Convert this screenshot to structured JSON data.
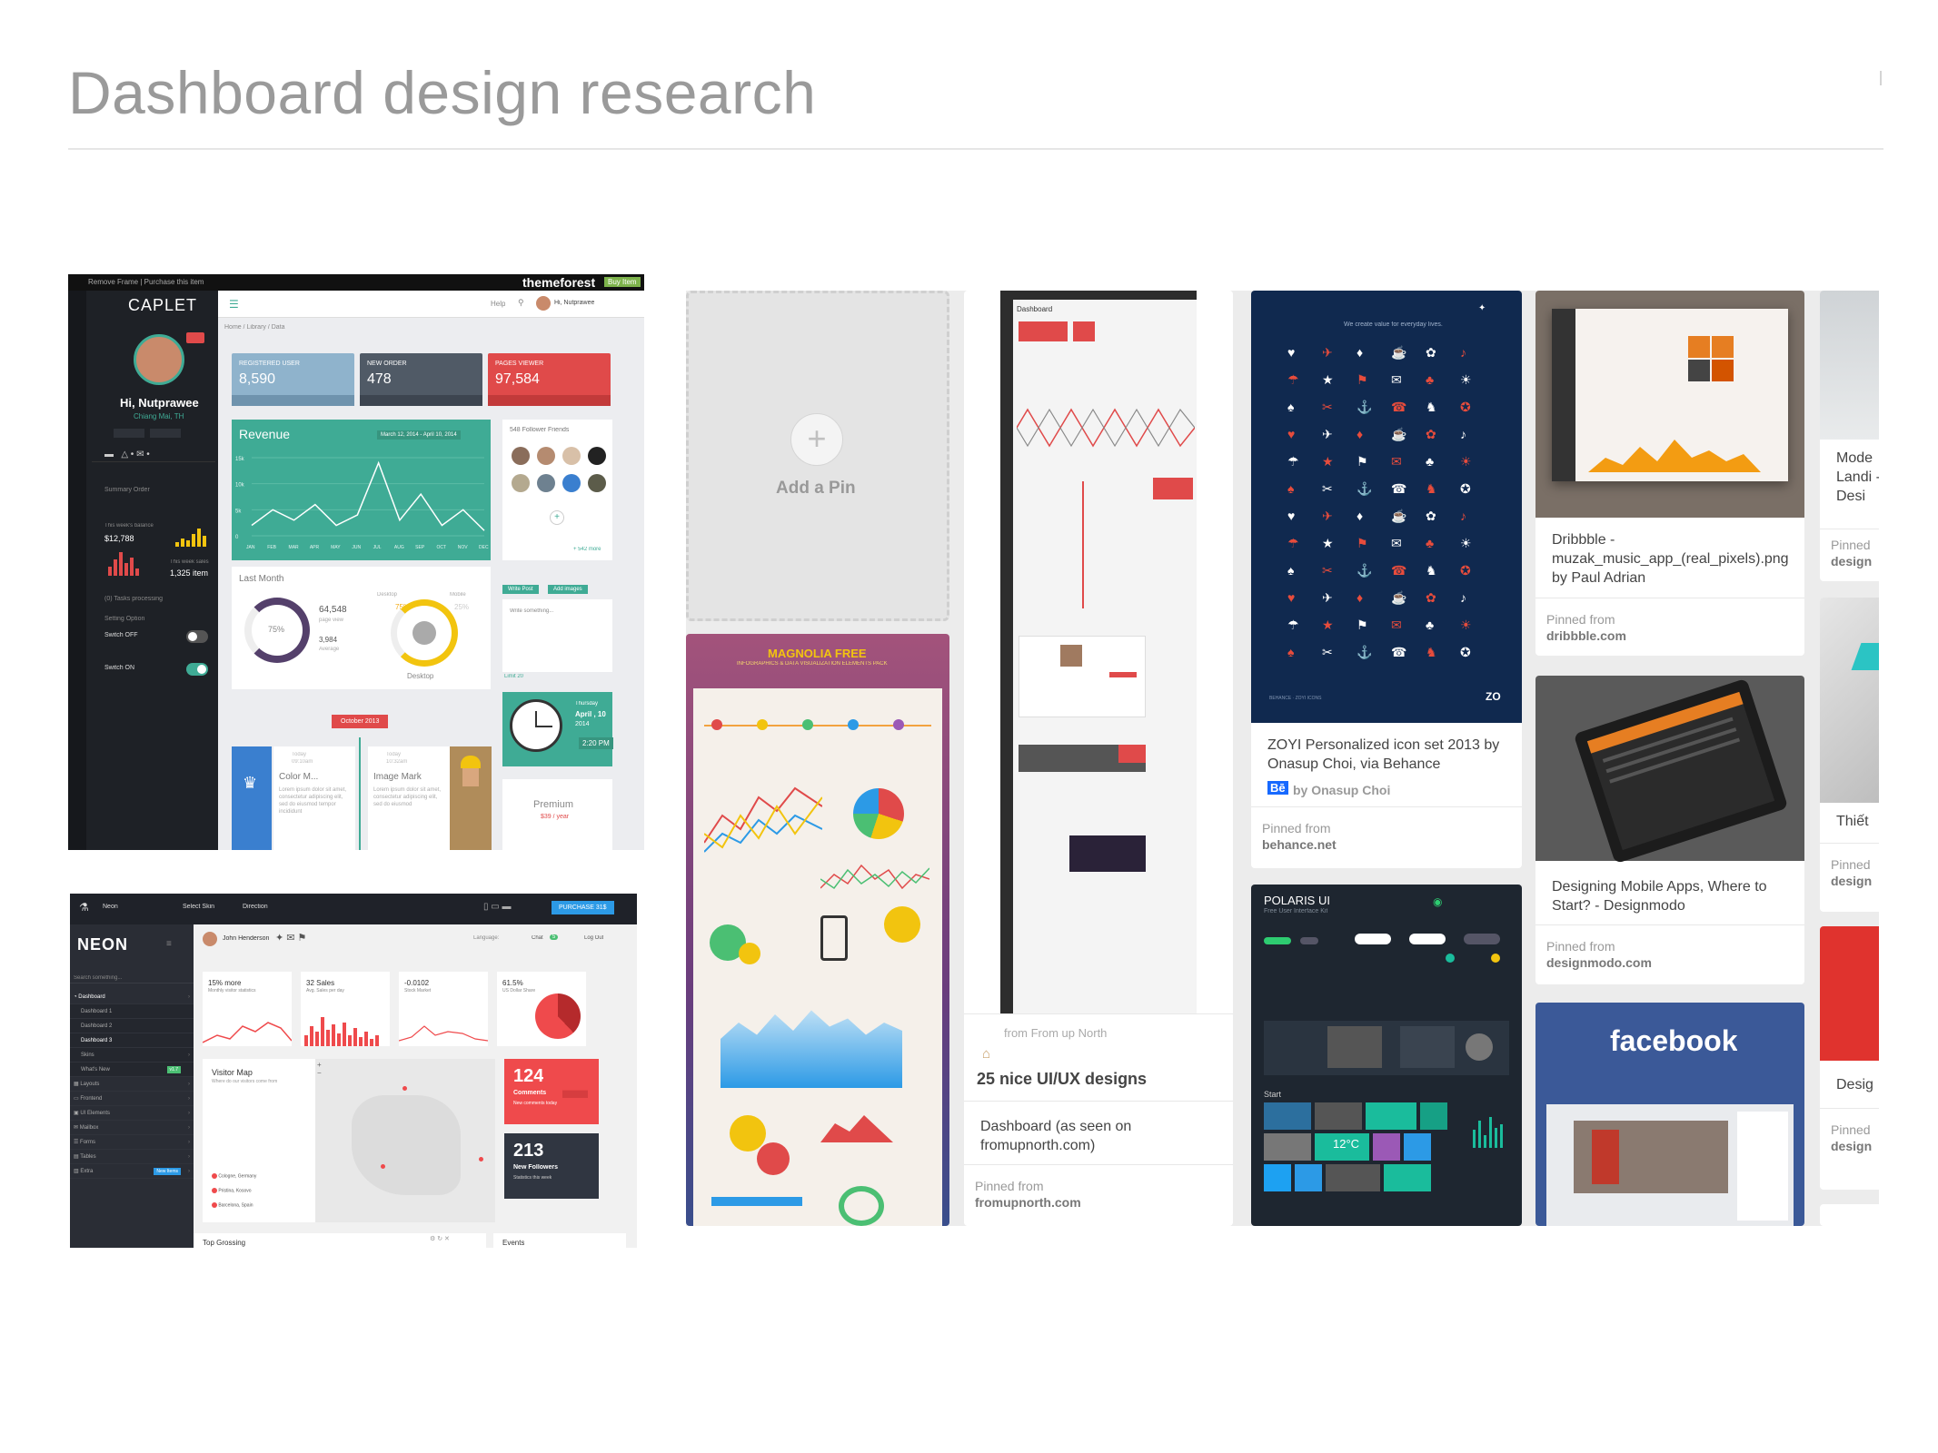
{
  "page": {
    "title": "Dashboard design research"
  },
  "caplet": {
    "banner_left": "Remove Frame   |   Purchase this item",
    "banner_brand": "themeforest",
    "banner_buy": "Buy Item",
    "brand": "CAPLET",
    "greeting": "Hi, Nutprawee",
    "location": "Chiang Mai, TH",
    "breadcrumb": "Home / Library / Data",
    "help": "Help",
    "top_user": "Hi, Nutprawee",
    "summary_label": "Summary Order",
    "balance_label": "This week's balance",
    "balance_value": "$12,788",
    "sales_label": "This week sales",
    "sales_value": "1,325 item",
    "tasks_label": "(0) Tasks processing",
    "setting_label": "Setting Option",
    "switch_off": "Switch OFF",
    "switch_on": "Switch ON",
    "tile1_label": "REGISTERED USER",
    "tile1_value": "8,590",
    "tile2_label": "NEW ORDER",
    "tile2_value": "478",
    "tile3_label": "PAGES VIEWER",
    "tile3_value": "97,584",
    "revenue_title": "Revenue",
    "revenue_range": "March 12, 2014 - April 10, 2014",
    "revenue_yticks": [
      "15k",
      "10k",
      "5k",
      "0"
    ],
    "revenue_months": [
      "JAN",
      "FEB",
      "MAR",
      "APR",
      "MAY",
      "JUN",
      "JUL",
      "AUG",
      "SEP",
      "OCT",
      "NOV",
      "DEC"
    ],
    "revenue_values": [
      2,
      5,
      3,
      6,
      2,
      4,
      14,
      3,
      8,
      2,
      5,
      1
    ],
    "friends_title": "548 Follower Friends",
    "friends_more": "+ 542 more",
    "last_month": "Last Month",
    "pageview_value": "64,548",
    "pageview_label": "page view",
    "avg_value": "3,984",
    "avg_label": "Average",
    "donut_pct": "75%",
    "desktop_legend": "Desktop",
    "mobile_legend": "Mobile",
    "desktop_pct": "75%",
    "mobile_pct": "25%",
    "desktop_label": "Desktop",
    "write_post": "Write Post",
    "add_images": "Add images",
    "write_placeholder": "Write something...",
    "limit": "Limit 20",
    "date_day": "Thursday",
    "date_date": "April , 10",
    "date_year": "2014",
    "date_time": "2:20 PM",
    "october": "October 2013",
    "tl1_when": "Today",
    "tl1_time": "09:10am",
    "tl1_title": "Color M...",
    "tl1_body": "Lorem ipsum dolor sit amet, consectetur adipiscing elit, sed do eiusmod tempor incididunt",
    "tl2_when": "Today",
    "tl2_time": "10:32am",
    "tl2_title": "Image Mark",
    "tl2_body": "Lorem ipsum dolor sit amet, consectetur adipiscing elit, sed do eiusmod",
    "premium": "Premium",
    "premium_price": "$39 / year"
  },
  "neon": {
    "brand_small": "Neon",
    "select_skin": "Select Skin",
    "direction": "Direction",
    "purchase": "PURCHASE 31$",
    "brand": "NEON",
    "search_placeholder": "Search something...",
    "user": "John Henderson",
    "language": "Language:",
    "chat": "Chat",
    "chat_count": "5",
    "logout": "Log Out",
    "nav": [
      "Dashboard",
      "Dashboard 1",
      "Dashboard 2",
      "Dashboard 3",
      "Skins",
      "What's New",
      "Layouts",
      "Frontend",
      "UI Elements",
      "Mailbox",
      "Forms",
      "Tables",
      "Extra"
    ],
    "whats_new_badge": "v1.7",
    "extra_badge": "New Items",
    "stat1_value": "15% more",
    "stat1_label": "Monthly visitor statistics",
    "stat2_value": "32 Sales",
    "stat2_label": "Avg. Sales per day",
    "stat3_value": "-0.0102",
    "stat3_label": "Stock Market",
    "stat4_value": "61.5%",
    "stat4_label": "US Dollar Share",
    "visitor_title": "Visitor Map",
    "visitor_sub": "Where do our visitors come from",
    "cities": [
      "Cologne, Germany",
      "Pristina, Kosovo",
      "Barcelona, Spain"
    ],
    "comments_value": "124",
    "comments_label": "Comments",
    "comments_sub": "New comments today",
    "followers_value": "213",
    "followers_label": "New Followers",
    "followers_sub": "Statistics this week",
    "top_grossing": "Top Grossing",
    "events": "Events"
  },
  "board": {
    "add_pin": "Add a Pin",
    "magnolia_title": "MAGNOLIA FREE",
    "magnolia_sub": "INFOGRAPHICS & DATA VISUALIZATION ELEMENTS PACK",
    "dashboard_label": "Dashboard",
    "fromupnorth_from": "from From up North",
    "fromupnorth_board": "25 nice UI/UX designs",
    "fromupnorth_desc": "Dashboard (as seen on fromupnorth.com)",
    "fromupnorth_pinned": "Pinned from",
    "fromupnorth_site": "fromupnorth.com",
    "zoyi_tagline": "We create value for everyday lives.",
    "zoyi_desc": "ZOYI Personalized icon set 2013 by Onasup Choi, via Behance",
    "zoyi_by": "by Onasup Choi",
    "zoyi_pinned": "Pinned from",
    "zoyi_site": "behance.net",
    "polaris_title": "POLARIS UI",
    "polaris_sub": "Free User Interface Kit",
    "polaris_start": "Start",
    "polaris_temp": "12°C",
    "dribbble_desc": "Dribbble - muzak_music_app_(real_pixels).png by Paul Adrian",
    "dribbble_pinned": "Pinned from",
    "dribbble_site": "dribbble.com",
    "designmodo_desc": "Designing Mobile Apps, Where to Start? - Designmodo",
    "designmodo_pinned": "Pinned from",
    "designmodo_site": "designmodo.com",
    "facebook_brand": "facebook",
    "col6_desc1": "Mode Landi - Desi",
    "col6_pinned1": "Pinned",
    "col6_site1": "design",
    "col6_desc2": "Thiết",
    "col6_pinned2": "Pinned",
    "col6_site2": "design",
    "col6_desc3": "Desig",
    "col6_pinned3": "Pinned",
    "col6_site3": "design"
  },
  "colors": {
    "caplet_teal": "#3fab95",
    "caplet_red": "#e04a4a",
    "caplet_blue": "#3a7fcf",
    "neon_red": "#ef4a4c",
    "neon_blue": "#2c9ae6",
    "board_bg": "#ececec",
    "zoyi_navy": "#10294f",
    "facebook_blue": "#3b5998"
  }
}
